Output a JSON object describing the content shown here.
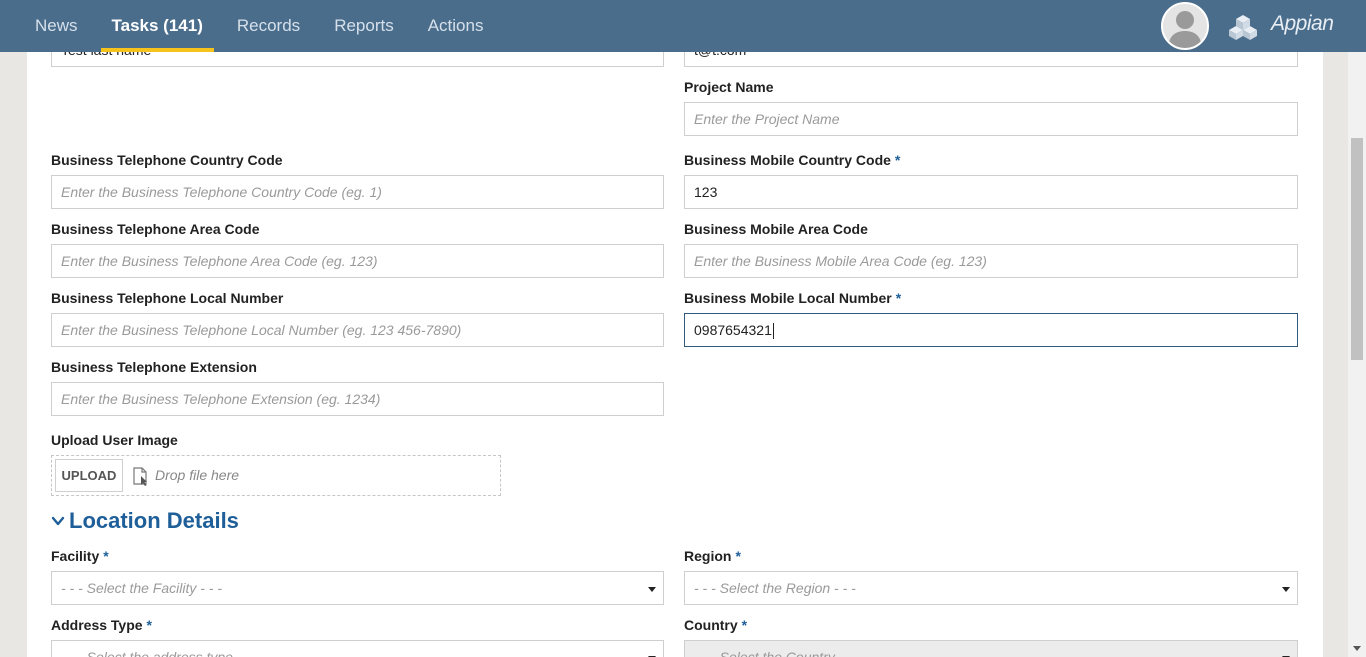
{
  "nav": {
    "items": [
      "News",
      "Tasks (141)",
      "Records",
      "Reports",
      "Actions"
    ],
    "active_index": 1
  },
  "brand": {
    "name": "Appian"
  },
  "form": {
    "last_name_partial": "Test last name",
    "email_partial": "t@t.com",
    "project_name": {
      "label": "Project Name",
      "placeholder": "Enter the Project Name"
    },
    "tel_country_code": {
      "label": "Business Telephone Country Code",
      "placeholder": "Enter the Business Telephone Country Code (eg. 1)"
    },
    "mobile_country_code": {
      "label": "Business Mobile Country Code",
      "required": "*",
      "value": "123"
    },
    "tel_area_code": {
      "label": "Business Telephone Area Code",
      "placeholder": "Enter the Business Telephone Area Code (eg. 123)"
    },
    "mobile_area_code": {
      "label": "Business Mobile Area Code",
      "placeholder": "Enter the Business Mobile Area Code (eg. 123)"
    },
    "tel_local_number": {
      "label": "Business Telephone Local Number",
      "placeholder": "Enter the Business Telephone Local Number (eg. 123 456-7890)"
    },
    "mobile_local_number": {
      "label": "Business Mobile Local Number",
      "required": "*",
      "value": "0987654321"
    },
    "tel_extension": {
      "label": "Business Telephone Extension",
      "placeholder": "Enter the Business Telephone Extension (eg. 1234)"
    },
    "upload": {
      "label": "Upload User Image",
      "button": "UPLOAD",
      "drop_text": "Drop file here"
    }
  },
  "location": {
    "title": "Location Details",
    "facility": {
      "label": "Facility",
      "required": "*",
      "placeholder": "- - - Select the Facility - - -"
    },
    "region": {
      "label": "Region",
      "required": "*",
      "placeholder": "- - - Select the Region - - -"
    },
    "address_type": {
      "label": "Address Type",
      "required": "*",
      "placeholder": "- - - Select the address type - - -"
    },
    "country": {
      "label": "Country",
      "required": "*",
      "placeholder": "- - - Select the Country - - -"
    }
  },
  "colors": {
    "topbar": "#4a6d8c",
    "accent": "#1f5f99",
    "active_tab_underline": "#f5c31b"
  },
  "icons": [
    "user-avatar-icon",
    "appian-cubes-icon",
    "file-icon",
    "chevron-down-icon",
    "select-arrow-icon"
  ]
}
